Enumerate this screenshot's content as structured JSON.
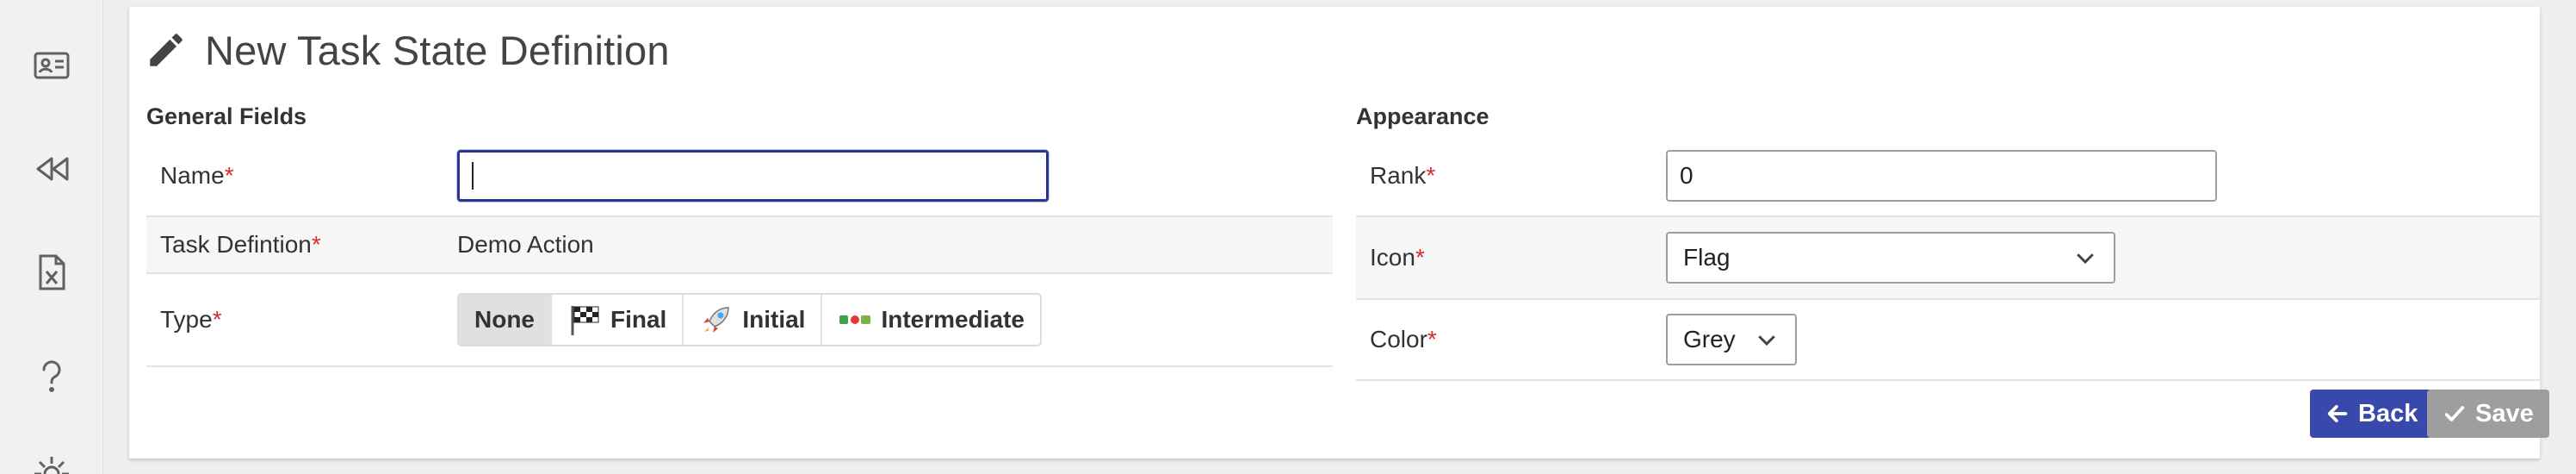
{
  "sidebar": {
    "icons": [
      "contact-card-icon",
      "rewind-icon",
      "excel-file-icon",
      "help-icon",
      "settings-icon"
    ]
  },
  "page": {
    "title": "New Task State Definition",
    "title_icon": "pencil-icon"
  },
  "general": {
    "section_title": "General Fields",
    "name_label": "Name",
    "name_value": "",
    "task_label": "Task Defintion",
    "task_value": "Demo Action",
    "type_label": "Type",
    "type_options": [
      {
        "label": "None",
        "icon": "",
        "selected": true
      },
      {
        "label": "Final",
        "icon": "checkered-flag-icon",
        "selected": false
      },
      {
        "label": "Initial",
        "icon": "rocket-icon",
        "selected": false
      },
      {
        "label": "Intermediate",
        "icon": "status-dots-icon",
        "selected": false
      }
    ]
  },
  "appearance": {
    "section_title": "Appearance",
    "rank_label": "Rank",
    "rank_value": "0",
    "icon_label": "Icon",
    "icon_value": "Flag",
    "color_label": "Color",
    "color_value": "Grey"
  },
  "required_marker": "*",
  "actions": {
    "back_label": "Back",
    "save_label": "Save"
  },
  "colors": {
    "required": "#d32f2f",
    "focus_border": "#283593",
    "back_button": "#3949ab",
    "save_button_disabled": "#9e9e9e"
  }
}
